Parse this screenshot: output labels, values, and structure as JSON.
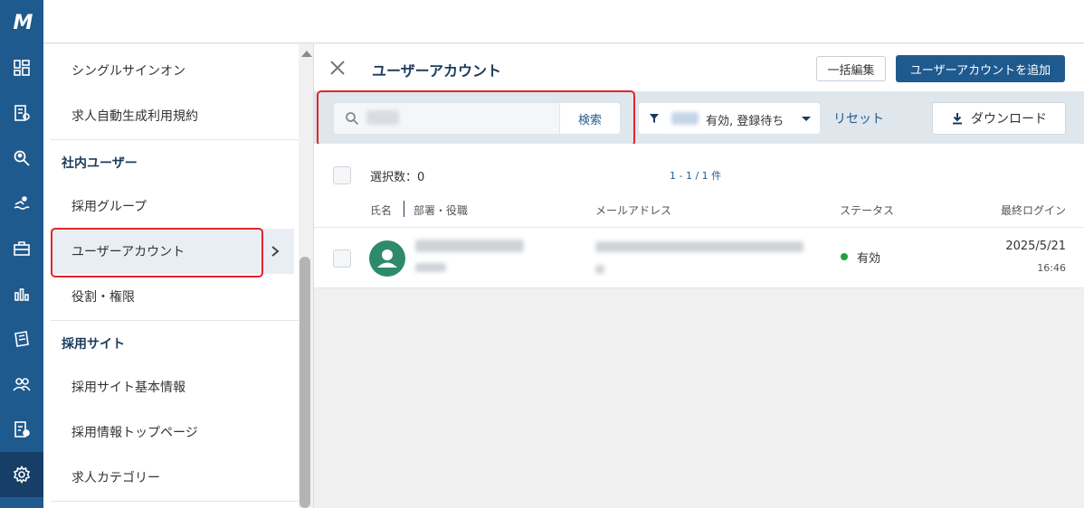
{
  "rail": {
    "logo": "M",
    "items": [
      "dashboard-icon",
      "report-icon",
      "search-people-icon",
      "swim-icon",
      "briefcase-icon",
      "bar-chart-icon",
      "document-icon",
      "users-icon",
      "edit-doc-icon",
      "settings-icon"
    ]
  },
  "sidebar": {
    "items_top": [
      {
        "label": "シングルサインオン"
      },
      {
        "label": "求人自動生成利用規約"
      }
    ],
    "section_internal": "社内ユーザー",
    "items_internal": [
      {
        "label": "採用グループ"
      },
      {
        "label": "ユーザーアカウント"
      },
      {
        "label": "役割・権限"
      }
    ],
    "section_site": "採用サイト",
    "items_site": [
      {
        "label": "採用サイト基本情報"
      },
      {
        "label": "採用情報トップページ"
      },
      {
        "label": "求人カテゴリー"
      }
    ]
  },
  "panel": {
    "title": "ユーザーアカウント",
    "bulk_edit": "一括編集",
    "add_account": "ユーザーアカウントを追加"
  },
  "filter": {
    "search_button": "検索",
    "filter_text": "有効, 登録待ち",
    "reset": "リセット",
    "download": "ダウンロード"
  },
  "list": {
    "selected_count": "選択数：0",
    "pager": "1 - 1 / 1 件",
    "columns": {
      "name": "氏名",
      "dept": "部署・役職",
      "email": "メールアドレス",
      "status": "ステータス",
      "last_login": "最終ログイン"
    },
    "rows": [
      {
        "status": "有効",
        "last_login_date": "2025/5/21",
        "last_login_time": "16:46"
      }
    ]
  },
  "colors": {
    "primary": "#1f5a8f",
    "highlight": "#e0262a",
    "status_active": "#22a33a"
  }
}
